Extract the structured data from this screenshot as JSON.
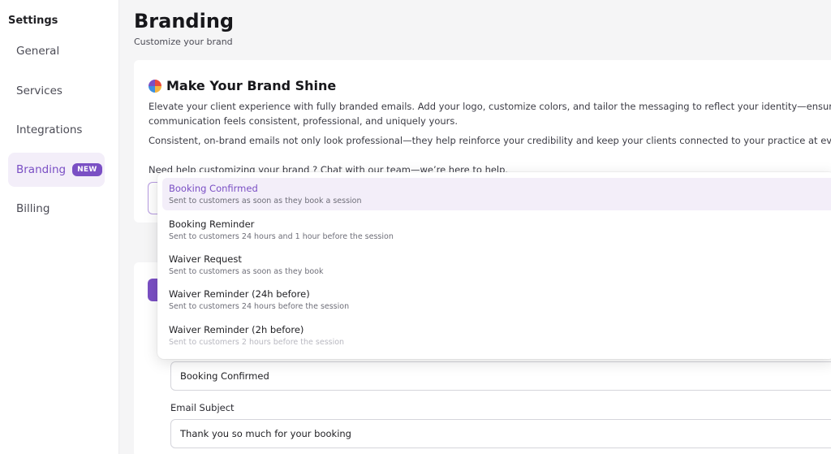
{
  "sidebar": {
    "title": "Settings",
    "items": [
      {
        "label": "General"
      },
      {
        "label": "Services"
      },
      {
        "label": "Integrations"
      },
      {
        "label": "Branding",
        "badge": "NEW"
      },
      {
        "label": "Billing"
      }
    ]
  },
  "header": {
    "title": "Branding",
    "subtitle": "Customize your brand"
  },
  "intro_card": {
    "heading": "Make Your Brand Shine",
    "para1_line1": "Elevate your client experience with fully branded emails. Add your logo, customize colors, and tailor the messaging to reflect your identity—ensuring ev",
    "para1_line2": "communication feels consistent, professional, and uniquely yours.",
    "para2": "Consistent, on-brand emails not only look professional—they help reinforce your credibility and keep your clients connected to your practice at every",
    "help_text": "Need help customizing your brand ? Chat with our team—we’re here to help."
  },
  "email_form": {
    "template_value": "Booking Confirmed",
    "subject_label": "Email Subject",
    "subject_value": "Thank you so much for your booking"
  },
  "template_dropdown": {
    "options": [
      {
        "name": "Booking Confirmed",
        "desc": "Sent to customers as soon as they book a session",
        "selected": true
      },
      {
        "name": "Booking Reminder",
        "desc": "Sent to customers 24 hours and 1 hour before the session"
      },
      {
        "name": "Waiver Request",
        "desc": "Sent to customers as soon as they book"
      },
      {
        "name": "Waiver Reminder (24h before)",
        "desc": "Sent to customers 24 hours before the session"
      },
      {
        "name": "Waiver Reminder (2h before)",
        "desc": "Sent to customers 2 hours before the session"
      }
    ]
  },
  "colors": {
    "accent": "#7a4fc4",
    "accent_bg": "#f3eef9"
  }
}
